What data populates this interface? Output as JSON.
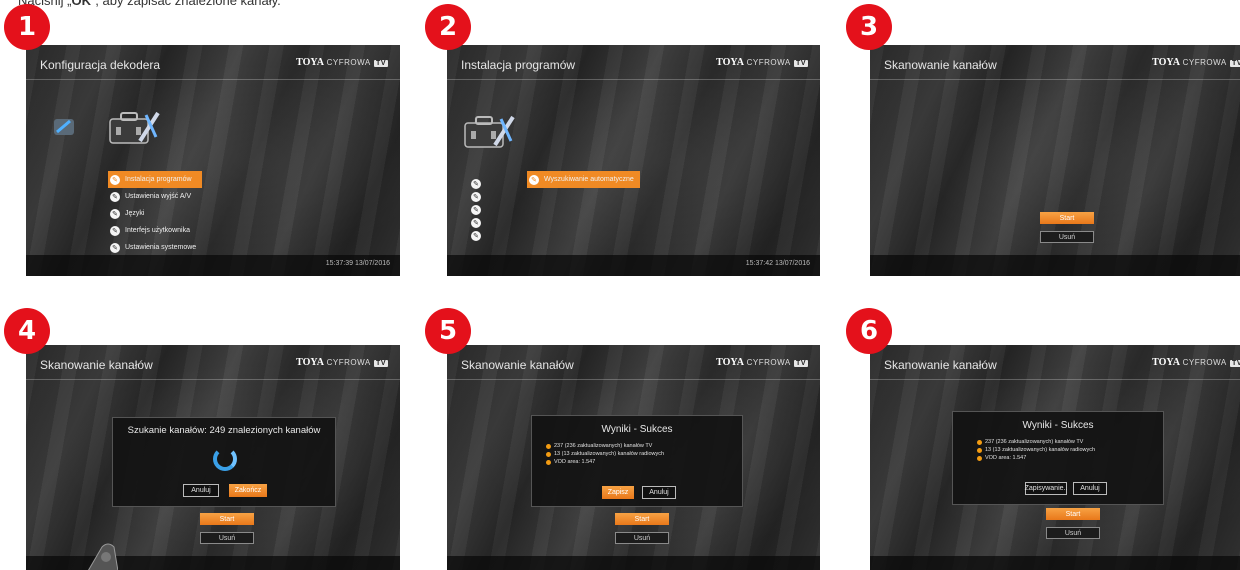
{
  "instruction": {
    "prefix": "Naciśnij „",
    "key": "OK",
    "suffix": "”, aby zapisać znalezione kanały."
  },
  "logo": {
    "brand": "TOYA",
    "text": "CYFROWA",
    "tv": "TV"
  },
  "colors": {
    "badge": "#e4111b",
    "accent": "#f08a24",
    "spinner": "#3aa0e8"
  },
  "steps": [
    {
      "badge": "1",
      "title": "Konfiguracja dekodera",
      "menu": [
        "Instalacja programów",
        "Ustawienia wyjść A/V",
        "Języki",
        "Interfejs użytkownika",
        "Ustawienia systemowe"
      ],
      "time": "15:37:39 13/07/2016"
    },
    {
      "badge": "2",
      "title": "Instalacja programów",
      "menu": [
        "Wyszukiwanie automatyczne"
      ],
      "time": "15:37:42 13/07/2016"
    },
    {
      "badge": "3",
      "title": "Skanowanie kanałów",
      "start": "Start",
      "remove": "Usuń"
    },
    {
      "badge": "4",
      "title": "Skanowanie kanałów",
      "dialog_title": "Szukanie kanałów: 249 znalezionych kanałów",
      "cancel": "Anuluj",
      "finish": "Zakończ",
      "start": "Start",
      "remove": "Usuń"
    },
    {
      "badge": "5",
      "title": "Skanowanie kanałów",
      "dialog_title": "Wyniki - Sukces",
      "results": [
        "237 (236 zaktualizowanych) kanałów TV",
        "13 (13 zaktualizowanych) kanałów radiowych",
        "VOD area: 1.547"
      ],
      "save": "Zapisz",
      "cancel": "Anuluj",
      "start": "Start",
      "remove": "Usuń"
    },
    {
      "badge": "6",
      "title": "Skanowanie kanałów",
      "dialog_title": "Wyniki - Sukces",
      "results": [
        "237 (236 zaktualizowanych) kanałów TV",
        "13 (13 zaktualizowanych) kanałów radiowych",
        "VOD area: 1.547"
      ],
      "saving": "Zapisywanie..",
      "cancel": "Anuluj",
      "start": "Start",
      "remove": "Usuń"
    }
  ]
}
